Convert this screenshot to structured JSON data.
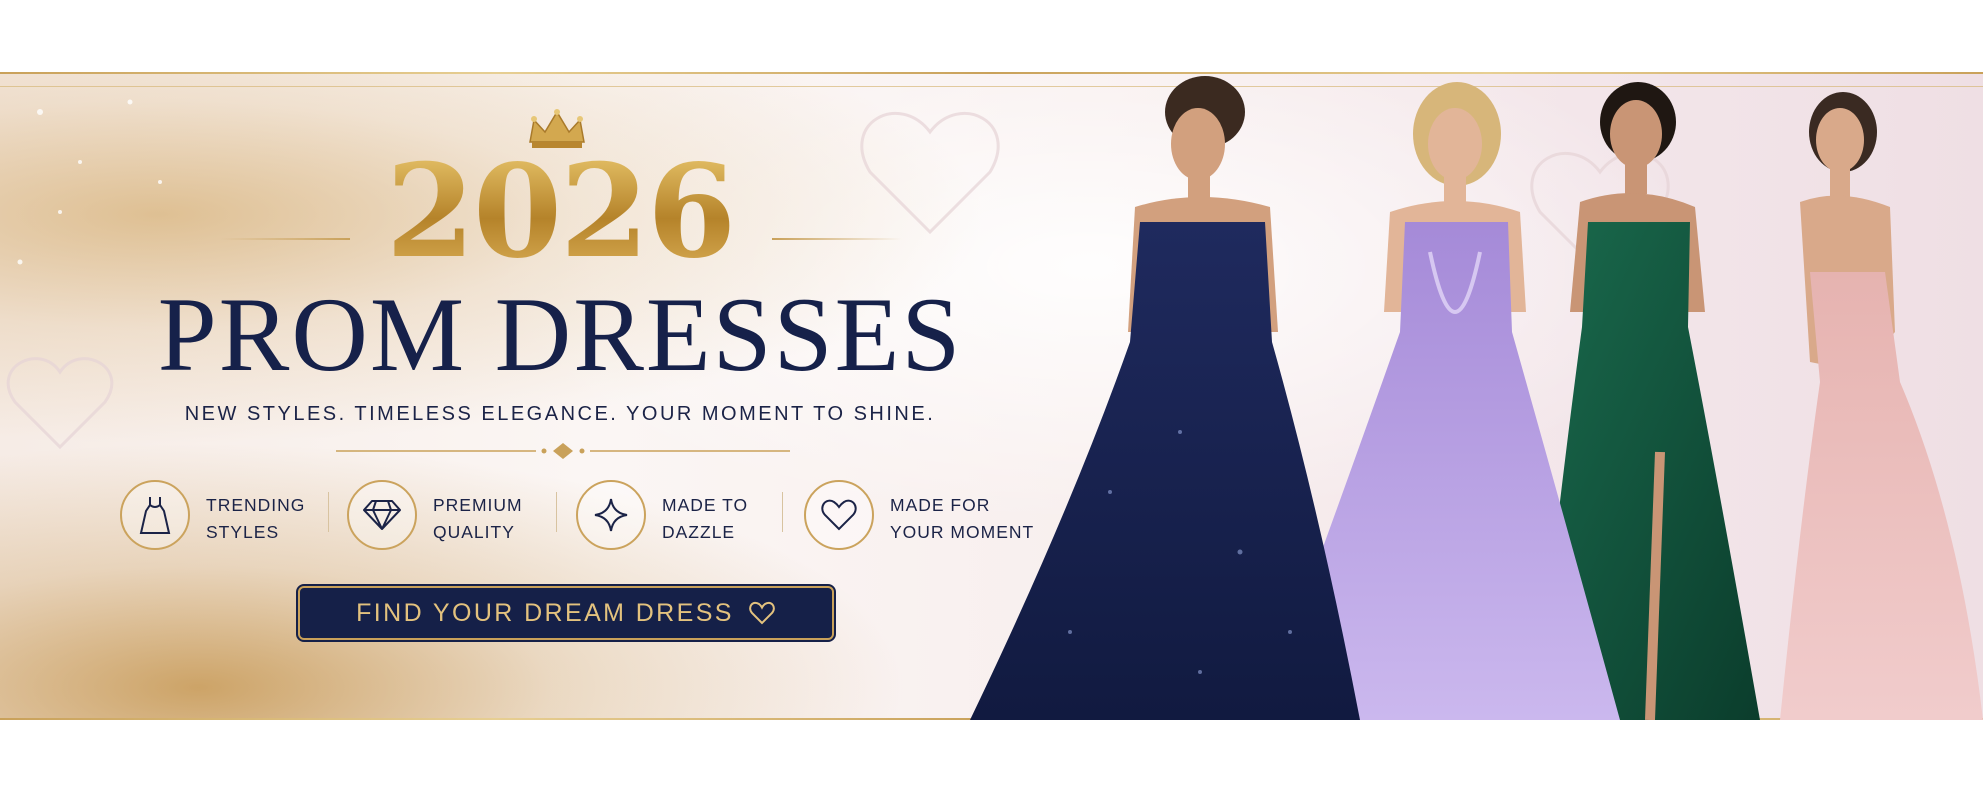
{
  "banner": {
    "year": "2026",
    "headline": "PROM DRESSES",
    "tagline": "NEW STYLES. TIMELESS ELEGANCE. YOUR MOMENT TO SHINE.",
    "features": [
      {
        "icon": "dress-icon",
        "line1": "TRENDING",
        "line2": "STYLES"
      },
      {
        "icon": "diamond-icon",
        "line1": "PREMIUM",
        "line2": "QUALITY"
      },
      {
        "icon": "sparkle-icon",
        "line1": "MADE TO",
        "line2": "DAZZLE"
      },
      {
        "icon": "heart-icon",
        "line1": "MADE FOR",
        "line2": "YOUR MOMENT"
      }
    ],
    "cta_label": "FIND YOUR DREAM DRESS"
  },
  "models": [
    {
      "dress_color": "navy sequin",
      "hex": "#1a2452"
    },
    {
      "dress_color": "lavender floral",
      "hex": "#b69be0"
    },
    {
      "dress_color": "emerald satin",
      "hex": "#0f4a36"
    },
    {
      "dress_color": "blush sparkle",
      "hex": "#e9b9b9"
    }
  ],
  "colors": {
    "navy": "#16214a",
    "gold": "#c9a15a"
  }
}
